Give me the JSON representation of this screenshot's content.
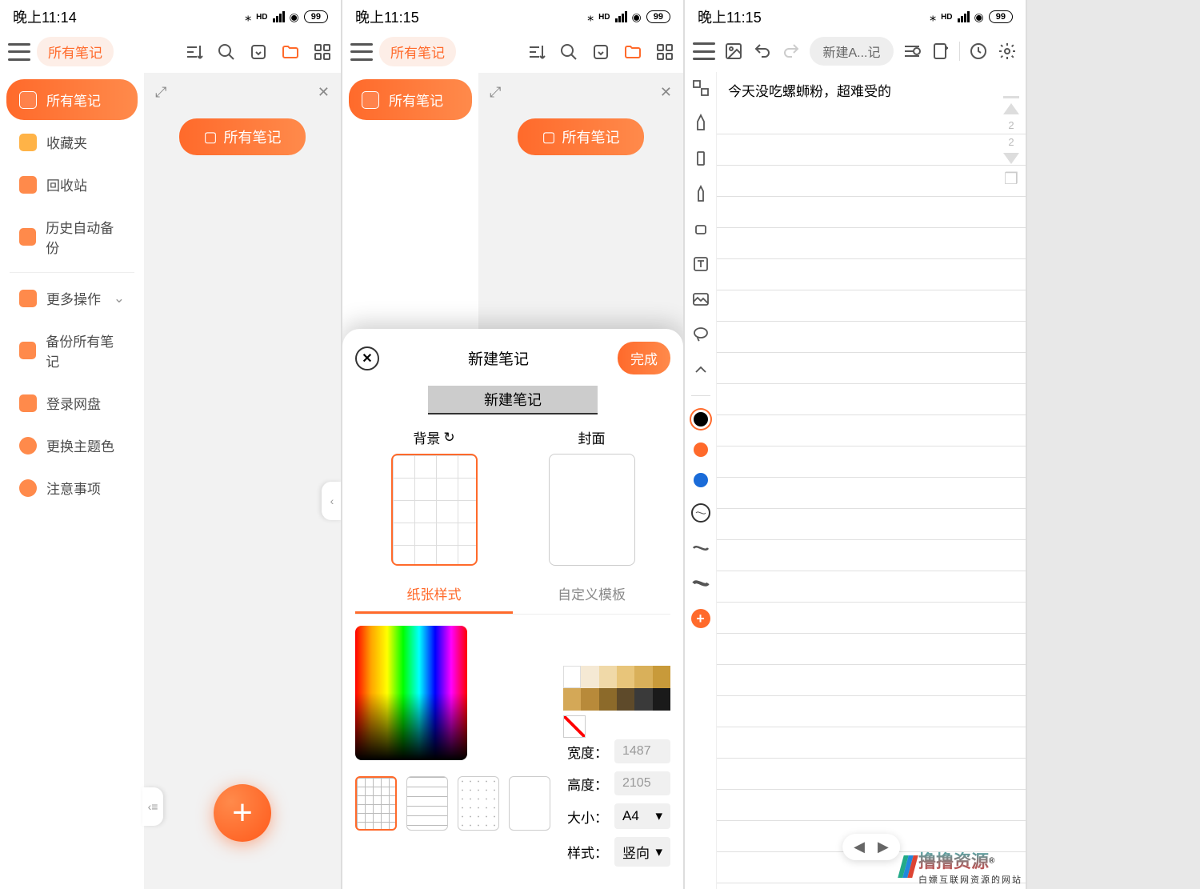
{
  "phone1": {
    "status_time": "晚上11:14",
    "battery": "99",
    "toolbar_pill": "所有笔记",
    "sidebar": [
      {
        "label": "所有笔记",
        "active": true,
        "color": "#fff"
      },
      {
        "label": "收藏夹",
        "color": "#ff8a4b"
      },
      {
        "label": "回收站",
        "color": "#ff8a4b"
      },
      {
        "label": "历史自动备份",
        "color": "#ff8a4b"
      },
      {
        "label": "更多操作",
        "color": "#ff8a4b",
        "expand": true
      },
      {
        "label": "备份所有笔记",
        "color": "#ff8a4b"
      },
      {
        "label": "登录网盘",
        "color": "#ff8a4b"
      },
      {
        "label": "更换主题色",
        "color": "#ff8a4b"
      },
      {
        "label": "注意事项",
        "color": "#ff8a4b"
      }
    ],
    "main_chip": "所有笔记"
  },
  "phone2": {
    "status_time": "晚上11:15",
    "battery": "99",
    "toolbar_pill": "所有笔记",
    "sidebar_active": "所有笔记",
    "main_chip": "所有笔记",
    "modal": {
      "title": "新建笔记",
      "done": "完成",
      "name_value": "新建笔记",
      "bg_label": "背景",
      "cover_label": "封面",
      "tab_paper": "纸张样式",
      "tab_custom": "自定义模板",
      "width_label": "宽度：",
      "width_value": "1487",
      "height_label": "高度：",
      "height_value": "2105",
      "size_label": "大小：",
      "size_value": "A4",
      "orient_label": "样式：",
      "orient_value": "竖向",
      "swatches_top": [
        "#ffffff",
        "#f5e9d4",
        "#f0d9a8",
        "#e8c57a",
        "#d9b05a",
        "#c89a3a"
      ],
      "swatches_bot": [
        "#d4a857",
        "#b88a3a",
        "#8c6a2a",
        "#5e4a2a",
        "#3a3a3a",
        "#1a1a1a"
      ]
    }
  },
  "phone3": {
    "status_time": "晚上11:15",
    "battery": "99",
    "crumb": "新建A...记",
    "note_text": "今天没吃螺蛳粉，超难受的",
    "layer_nums": [
      "2",
      "2"
    ],
    "watermark_main": "撸撸资源",
    "watermark_sub": "白嫖互联网资源的网站"
  }
}
